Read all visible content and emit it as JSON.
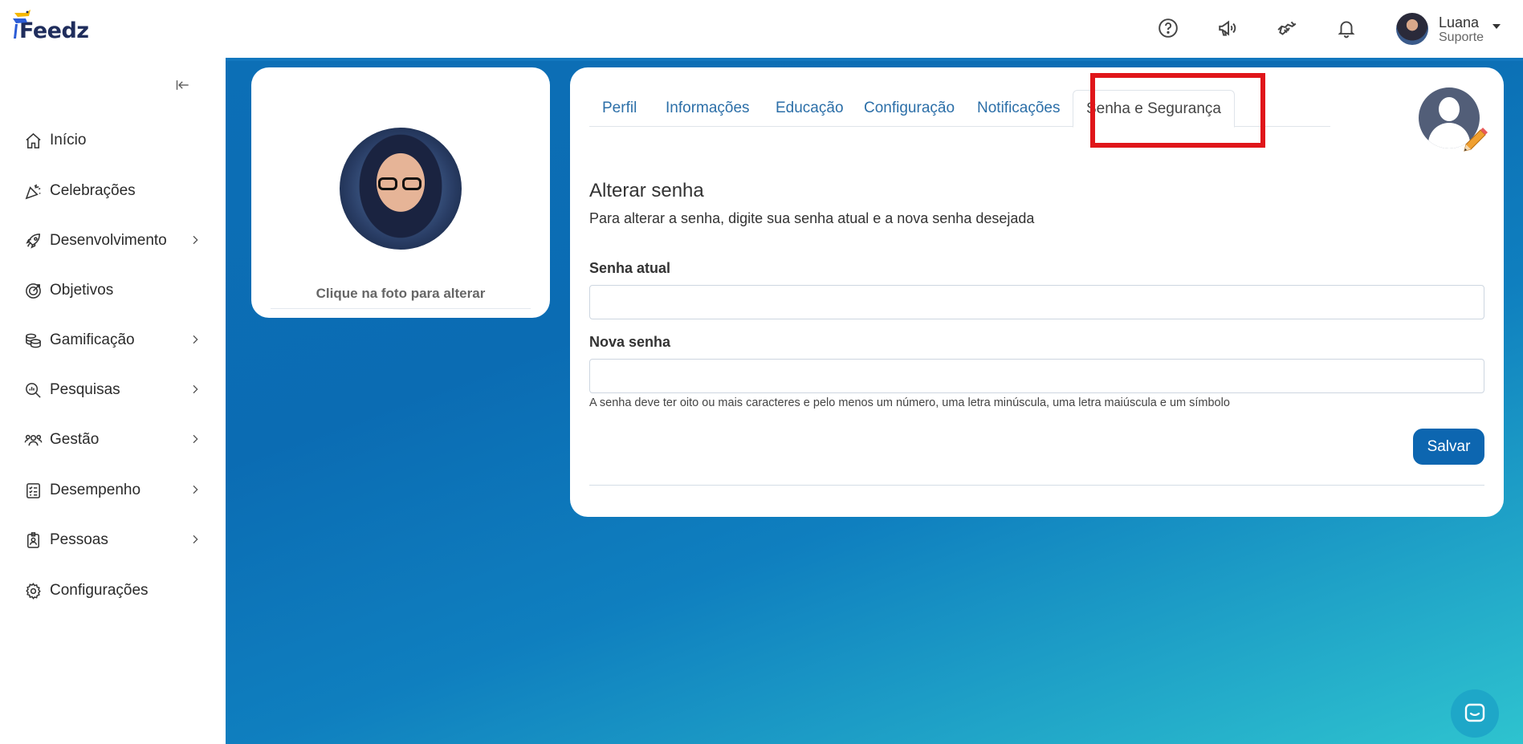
{
  "app": {
    "logo_text": "Feedz",
    "brand_colors": {
      "primary": "#0d66b0",
      "accent_red": "#e0161a",
      "logo_yellow": "#f5b800",
      "logo_blue": "#2b5cd6"
    }
  },
  "header": {
    "icons": [
      "help-icon",
      "megaphone-icon",
      "handshake-icon",
      "bell-icon"
    ],
    "user": {
      "name": "Luana",
      "role": "Suporte"
    }
  },
  "sidebar": {
    "items": [
      {
        "label": "Início",
        "icon": "home-icon",
        "has_submenu": false
      },
      {
        "label": "Celebrações",
        "icon": "party-icon",
        "has_submenu": false
      },
      {
        "label": "Desenvolvimento",
        "icon": "rocket-icon",
        "has_submenu": true
      },
      {
        "label": "Objetivos",
        "icon": "target-icon",
        "has_submenu": false
      },
      {
        "label": "Gamificação",
        "icon": "coins-icon",
        "has_submenu": true
      },
      {
        "label": "Pesquisas",
        "icon": "search-chart-icon",
        "has_submenu": true
      },
      {
        "label": "Gestão",
        "icon": "people-icon",
        "has_submenu": true
      },
      {
        "label": "Desempenho",
        "icon": "checklist-icon",
        "has_submenu": true
      },
      {
        "label": "Pessoas",
        "icon": "badge-icon",
        "has_submenu": true
      },
      {
        "label": "Configurações",
        "icon": "gear-icon",
        "has_submenu": false
      }
    ]
  },
  "photo_card": {
    "caption": "Clique na foto para alterar"
  },
  "tabs": [
    {
      "label": "Perfil",
      "active": false
    },
    {
      "label": "Informações",
      "active": false
    },
    {
      "label": "Educação",
      "active": false
    },
    {
      "label": "Configuração",
      "active": false
    },
    {
      "label": "Notificações",
      "active": false
    },
    {
      "label": "Senha e Segurança",
      "active": true
    }
  ],
  "form": {
    "title": "Alterar senha",
    "subtitle": "Para alterar a senha, digite sua senha atual e a nova senha desejada",
    "current_password_label": "Senha atual",
    "current_password_value": "",
    "new_password_label": "Nova senha",
    "new_password_value": "",
    "hint": "A senha deve ter oito ou mais caracteres e pelo menos um número, uma letra minúscula, uma letra maiúscula e um símbolo",
    "save_label": "Salvar"
  }
}
